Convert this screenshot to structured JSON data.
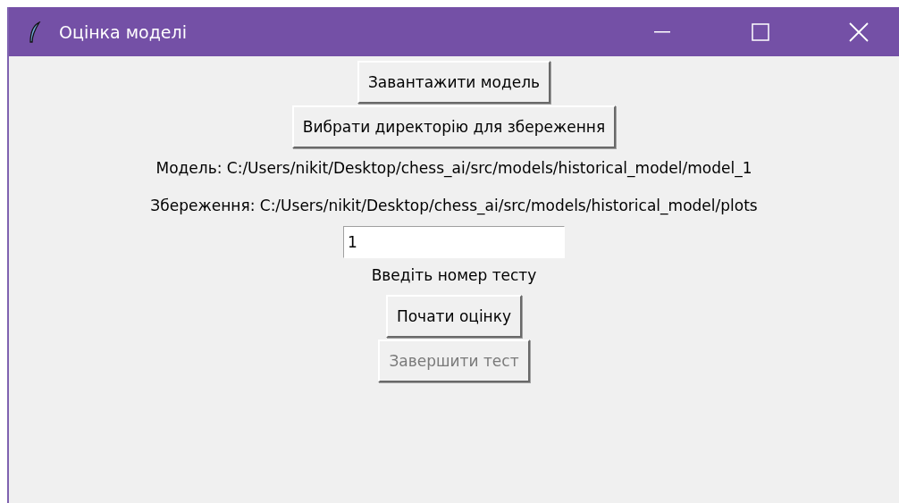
{
  "window": {
    "title": "Оцінка моделі"
  },
  "items": [
    {
      "kind": "button",
      "label": "Завантажити модель",
      "disabled": false
    },
    {
      "kind": "button",
      "label": "Вибрати директорію для збереження",
      "disabled": false
    },
    {
      "kind": "label",
      "text": "Модель: C:/Users/nikit/Desktop/chess_ai/src/models/historical_model/model_1"
    },
    {
      "kind": "label",
      "text": "Збереження: C:/Users/nikit/Desktop/chess_ai/src/models/historical_model/plots"
    },
    {
      "kind": "entry",
      "value": "1"
    },
    {
      "kind": "label",
      "text": "Введіть номер тесту"
    },
    {
      "kind": "button",
      "label": "Почати оцінку",
      "disabled": false
    },
    {
      "kind": "button",
      "label": "Завершити тест",
      "disabled": true
    }
  ]
}
